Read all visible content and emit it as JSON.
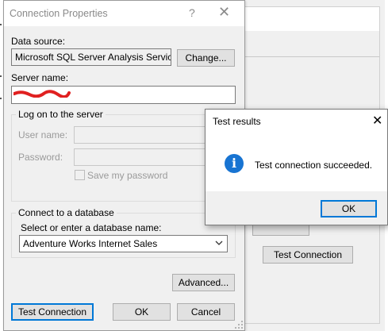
{
  "connection_dialog": {
    "title": "Connection Properties",
    "help_glyph": "?",
    "close_glyph": "✕",
    "data_source_label": "Data source:",
    "data_source_value": "Microsoft SQL Server Analysis Services",
    "change_button": "Change...",
    "server_name_label": "Server name:",
    "server_name_value": "",
    "logon_group_title": "Log on to the server",
    "user_name_label": "User name:",
    "password_label": "Password:",
    "save_password_label": "Save my password",
    "connect_db_group_title": "Connect to a database",
    "select_db_label": "Select or enter a database name:",
    "database_value": "Adventure Works Internet Sales",
    "advanced_button": "Advanced...",
    "test_connection_button": "Test Connection",
    "ok_button": "OK",
    "cancel_button": "Cancel"
  },
  "background_window": {
    "test_connection_button": "Test Connection"
  },
  "test_results_dialog": {
    "title": "Test results",
    "close_glyph": "✕",
    "message": "Test connection succeeded.",
    "icon_glyph": "i",
    "ok_button": "OK"
  },
  "colors": {
    "accent": "#0078d7",
    "info_icon": "#1874d2",
    "redaction": "#e02020"
  }
}
